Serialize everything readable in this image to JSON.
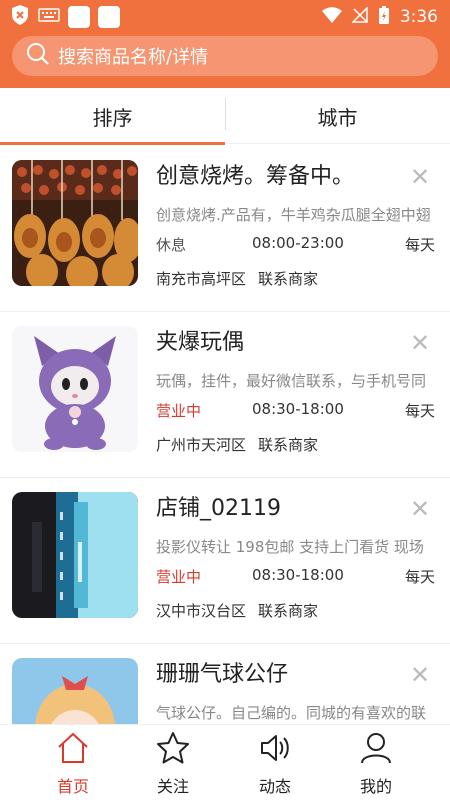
{
  "status_bar": {
    "time": "3:36"
  },
  "search": {
    "placeholder": "搜索商品名称/详情"
  },
  "filters": {
    "sort_label": "排序",
    "city_label": "城市"
  },
  "items": [
    {
      "title": "创意烧烤。筹备中。",
      "description": "创意烧烤.产品有，牛羊鸡杂瓜腿全翅中翅",
      "status": "休息",
      "hours": "08:00-23:00",
      "days": "每天",
      "location": "南充市高坪区",
      "contact": "联系商家"
    },
    {
      "title": "夹爆玩偶",
      "description": "玩偶，挂件，最好微信联系，与手机号同",
      "status": "营业中",
      "hours": "08:30-18:00",
      "days": "每天",
      "location": "广州市天河区",
      "contact": "联系商家"
    },
    {
      "title": "店铺_02119",
      "description": "投影仪转让  198包邮  支持上门看货  现场",
      "status": "营业中",
      "hours": "08:30-18:00",
      "days": "每天",
      "location": "汉中市汉台区",
      "contact": "联系商家"
    },
    {
      "title": "珊珊气球公仔",
      "description": "气球公仔。自己编的。同城的有喜欢的联"
    }
  ],
  "nav": {
    "home": "首页",
    "follow": "关注",
    "activity": "动态",
    "mine": "我的"
  },
  "colors": {
    "accent": "#f0703e",
    "open": "#d83b2c"
  }
}
